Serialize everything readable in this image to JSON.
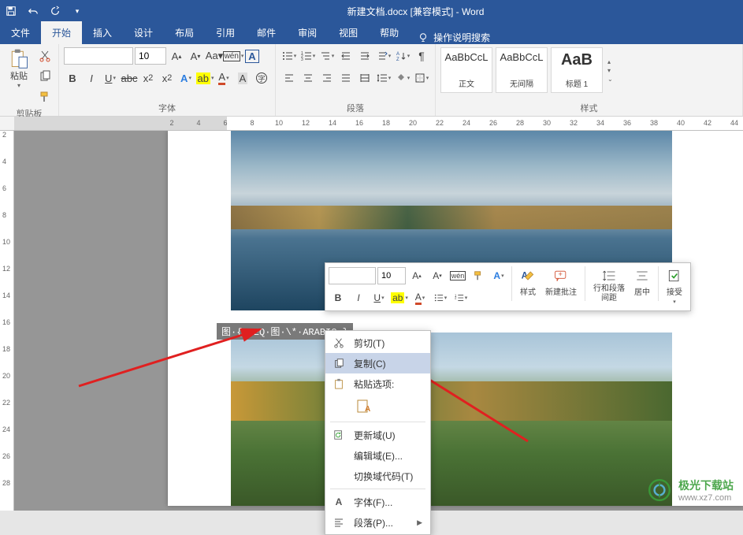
{
  "title": "新建文档.docx [兼容模式] - Word",
  "tabs": {
    "file": "文件",
    "home": "开始",
    "insert": "插入",
    "design": "设计",
    "layout": "布局",
    "references": "引用",
    "mailings": "邮件",
    "review": "审阅",
    "view": "视图",
    "help": "帮助",
    "tell_me": "操作说明搜索"
  },
  "ribbon": {
    "paste": "粘贴",
    "clipboard": "剪贴板",
    "font_label": "字体",
    "font_size": "10",
    "paragraph": "段落",
    "styles": "样式",
    "style_items": [
      {
        "preview": "AaBbCcL",
        "name": "正文"
      },
      {
        "preview": "AaBbCcL",
        "name": "无间隔"
      },
      {
        "preview": "AaB",
        "name": "标题 1"
      }
    ]
  },
  "ruler_h": [
    "2",
    "4",
    "6",
    "8",
    "10",
    "12",
    "14",
    "16",
    "18",
    "20",
    "22",
    "24",
    "26",
    "28",
    "30",
    "32",
    "34",
    "36",
    "38",
    "40",
    "42",
    "44"
  ],
  "ruler_v": [
    "2",
    "4",
    "6",
    "8",
    "10",
    "12",
    "14",
    "16",
    "18",
    "20",
    "22",
    "24",
    "26",
    "28"
  ],
  "field_code": "图·{·SEQ·图·\\*·ARABIC·}",
  "mini": {
    "font_size": "10",
    "styles": "样式",
    "new_comment": "新建批注",
    "line_para_spacing_l1": "行和段落",
    "line_para_spacing_l2": "间距",
    "center": "居中",
    "accept": "接受"
  },
  "ctx": {
    "cut": "剪切(T)",
    "copy": "复制(C)",
    "paste_options": "粘贴选项:",
    "update_field": "更新域(U)",
    "edit_field": "编辑域(E)...",
    "toggle_field": "切换域代码(T)",
    "font": "字体(F)...",
    "paragraph": "段落(P)..."
  },
  "watermark": {
    "name": "极光下载站",
    "url": "www.xz7.com"
  }
}
